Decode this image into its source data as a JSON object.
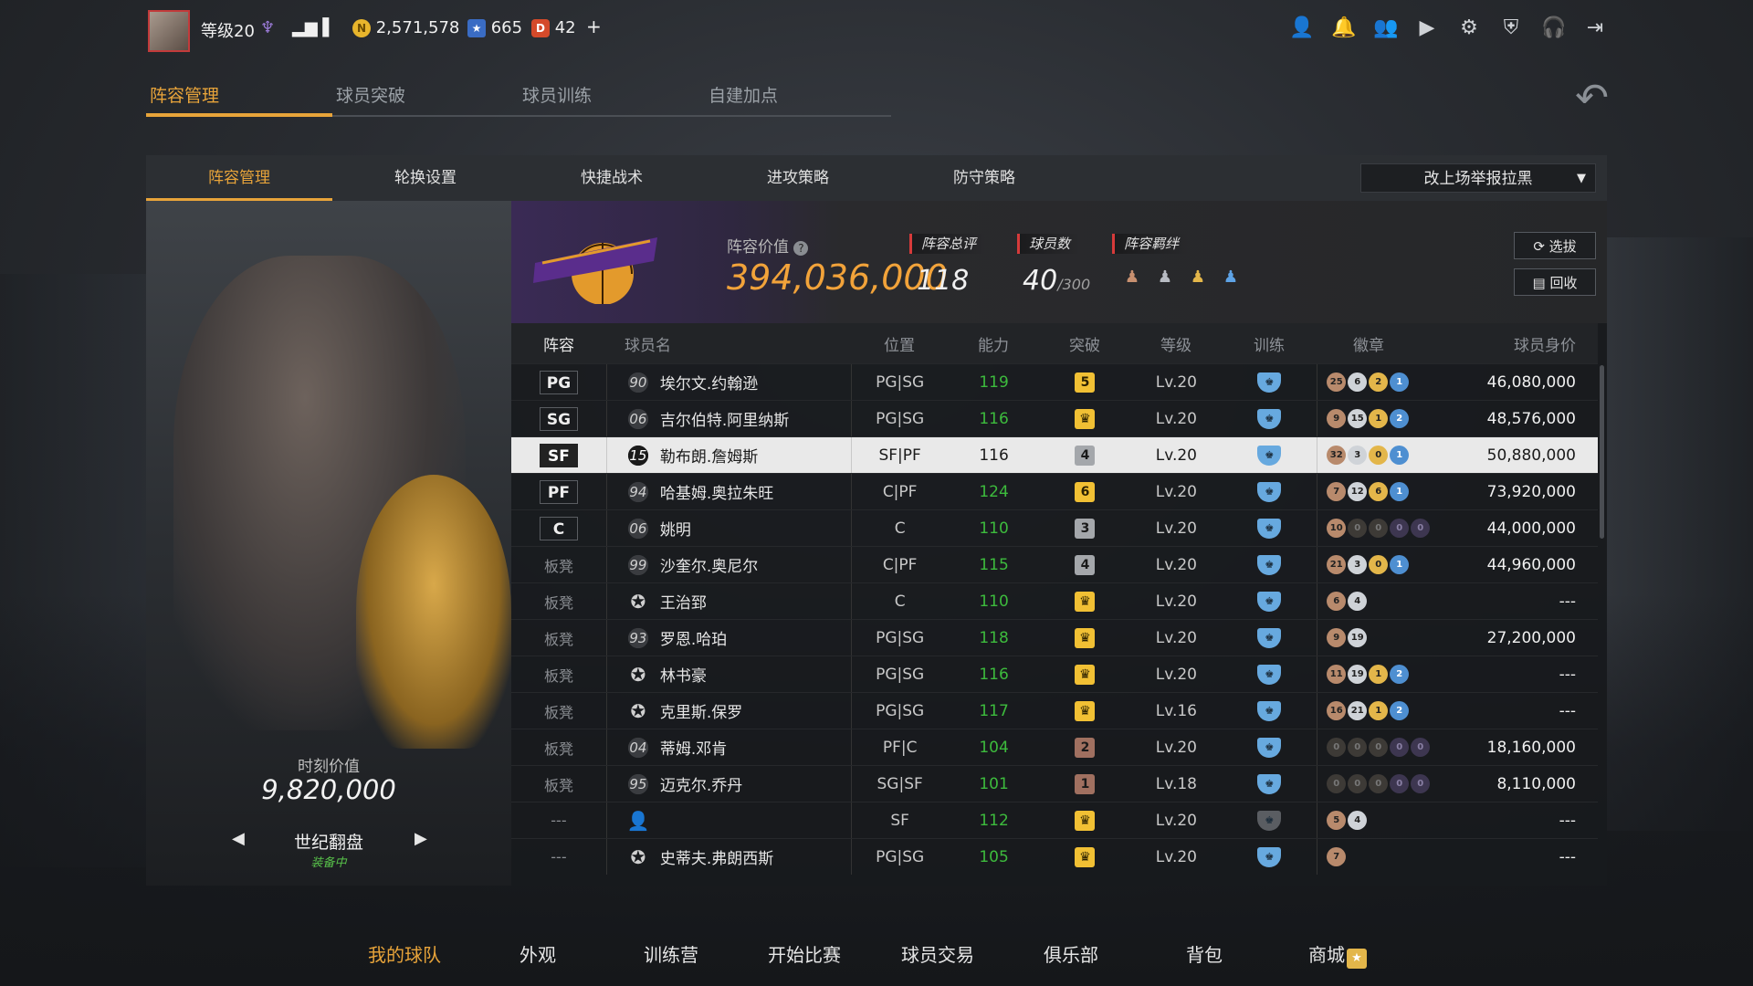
{
  "topbar": {
    "level": "等级20",
    "coins": "2,571,578",
    "stars": "665",
    "tickets": "42",
    "add": "+"
  },
  "main_tabs": [
    "阵容管理",
    "球员突破",
    "球员训练",
    "自建加点"
  ],
  "sub_tabs": [
    "阵容管理",
    "轮换设置",
    "快捷战术",
    "进攻策略",
    "防守策略"
  ],
  "dropdown": "改上场举报拉黑",
  "card": {
    "value_label": "时刻价值",
    "value": "9,820,000",
    "skin": "世纪翻盘",
    "equip": "装备中"
  },
  "team": {
    "value_label": "阵容价值",
    "value": "394,036,000",
    "rating_label": "阵容总评",
    "rating": "118",
    "players_label": "球员数",
    "players": "40",
    "players_max": "/300",
    "bond_label": "阵容羁绊",
    "select_btn": "选拔",
    "recycle_btn": "回收"
  },
  "table": {
    "headers": [
      "阵容",
      "球员名",
      "位置",
      "能力",
      "突破",
      "等级",
      "训练",
      "徽章",
      "球员身价"
    ],
    "rows": [
      {
        "slot": "PG",
        "num": "90",
        "name": "埃尔文.约翰逊",
        "pos": "PG|SG",
        "abil": "119",
        "brk": "5",
        "lvl": "Lv.20",
        "badges": [
          "25",
          "6",
          "2",
          "1"
        ],
        "price": "46,080,000"
      },
      {
        "slot": "SG",
        "num": "06",
        "name": "吉尔伯特.阿里纳斯",
        "pos": "PG|SG",
        "abil": "116",
        "brk": "",
        "lvl": "Lv.20",
        "badges": [
          "9",
          "15",
          "1",
          "2"
        ],
        "price": "48,576,000"
      },
      {
        "slot": "SF",
        "num": "15",
        "name": "勒布朗.詹姆斯",
        "pos": "SF|PF",
        "abil": "116",
        "brk": "4",
        "lvl": "Lv.20",
        "badges": [
          "32",
          "3",
          "0",
          "1"
        ],
        "price": "50,880,000"
      },
      {
        "slot": "PF",
        "num": "94",
        "name": "哈基姆.奥拉朱旺",
        "pos": "C|PF",
        "abil": "124",
        "brk": "6",
        "lvl": "Lv.20",
        "badges": [
          "7",
          "12",
          "6",
          "1"
        ],
        "price": "73,920,000"
      },
      {
        "slot": "C",
        "num": "06",
        "name": "姚明",
        "pos": "C",
        "abil": "110",
        "brk": "3",
        "lvl": "Lv.20",
        "badges": [
          "10",
          "0",
          "0",
          "0",
          "0"
        ],
        "price": "44,000,000"
      },
      {
        "slot": "板凳",
        "num": "99",
        "name": "沙奎尔.奥尼尔",
        "pos": "C|PF",
        "abil": "115",
        "brk": "4",
        "lvl": "Lv.20",
        "badges": [
          "21",
          "3",
          "0",
          "1"
        ],
        "price": "44,960,000"
      },
      {
        "slot": "板凳",
        "num": "",
        "name": "王治郅",
        "pos": "C",
        "abil": "110",
        "brk": "",
        "lvl": "Lv.20",
        "badges": [
          "6",
          "4"
        ],
        "price": "---"
      },
      {
        "slot": "板凳",
        "num": "93",
        "name": "罗恩.哈珀",
        "pos": "PG|SG",
        "abil": "118",
        "brk": "",
        "lvl": "Lv.20",
        "badges": [
          "9",
          "19"
        ],
        "price": "27,200,000"
      },
      {
        "slot": "板凳",
        "num": "",
        "name": "林书豪",
        "pos": "PG|SG",
        "abil": "116",
        "brk": "",
        "lvl": "Lv.20",
        "badges": [
          "11",
          "19",
          "1",
          "2"
        ],
        "price": "---"
      },
      {
        "slot": "板凳",
        "num": "",
        "name": "克里斯.保罗",
        "pos": "PG|SG",
        "abil": "117",
        "brk": "",
        "lvl": "Lv.16",
        "badges": [
          "16",
          "21",
          "1",
          "2"
        ],
        "price": "---"
      },
      {
        "slot": "板凳",
        "num": "04",
        "name": "蒂姆.邓肯",
        "pos": "PF|C",
        "abil": "104",
        "brk": "2",
        "lvl": "Lv.20",
        "badges": [
          "0",
          "0",
          "0",
          "0",
          "0"
        ],
        "price": "18,160,000"
      },
      {
        "slot": "板凳",
        "num": "95",
        "name": "迈克尔.乔丹",
        "pos": "SG|SF",
        "abil": "101",
        "brk": "1",
        "lvl": "Lv.18",
        "badges": [
          "0",
          "0",
          "0",
          "0",
          "0"
        ],
        "price": "8,110,000"
      },
      {
        "slot": "---",
        "num": "",
        "name": "",
        "pos": "SF",
        "abil": "112",
        "brk": "",
        "lvl": "Lv.20",
        "badges": [
          "5",
          "4"
        ],
        "price": "---"
      },
      {
        "slot": "---",
        "num": "",
        "name": "史蒂夫.弗朗西斯",
        "pos": "PG|SG",
        "abil": "105",
        "brk": "",
        "lvl": "Lv.20",
        "badges": [
          "7"
        ],
        "price": "---"
      }
    ]
  },
  "bottom_nav": [
    "我的球队",
    "外观",
    "训练营",
    "开始比赛",
    "球员交易",
    "俱乐部",
    "背包",
    "商城"
  ],
  "colors": {
    "accent": "#e8a43a",
    "ability": "#3dbb3d",
    "shield": "#67a9df"
  }
}
